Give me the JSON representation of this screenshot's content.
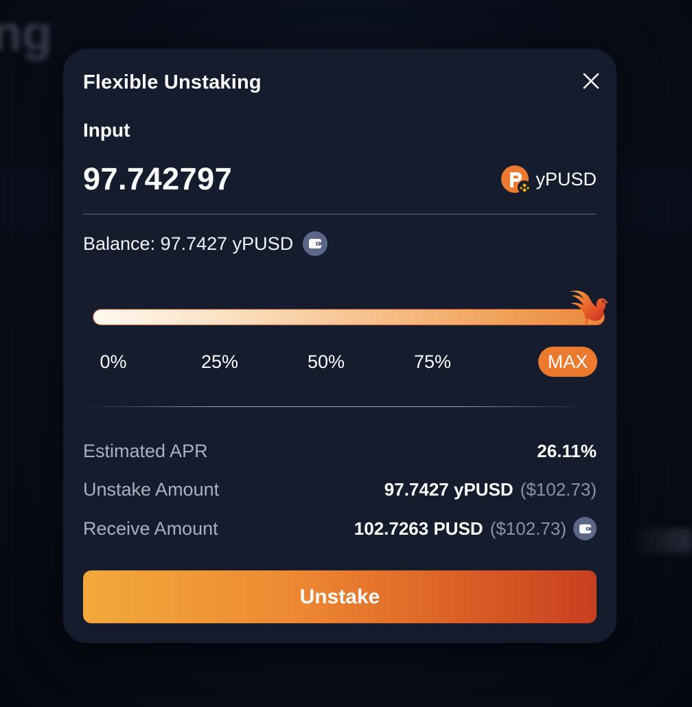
{
  "modal": {
    "title": "Flexible Unstaking",
    "input_label": "Input",
    "amount": "97.742797",
    "token": {
      "symbol": "yPUSD",
      "logo_icon": "pusd-token-logo",
      "badge_icon": "chain-badge-icon"
    },
    "balance": {
      "text": "Balance: 97.7427 yPUSD",
      "icon": "wallet-icon"
    },
    "slider": {
      "percent": 100,
      "thumb_icon": "phoenix-icon",
      "ticks": [
        "0%",
        "25%",
        "50%",
        "75%",
        "MAX"
      ],
      "active_tick": "MAX"
    },
    "info": {
      "apr": {
        "label": "Estimated APR",
        "value": "26.11%"
      },
      "unstake": {
        "label": "Unstake Amount",
        "value": "97.7427 yPUSD",
        "usd": "($102.73)"
      },
      "receive": {
        "label": "Receive Amount",
        "value": "102.7263 PUSD",
        "usd": "($102.73)",
        "icon": "wallet-icon"
      }
    },
    "button_label": "Unstake"
  },
  "colors": {
    "accent": "#ec7a2e",
    "modal_bg": "#151c2e",
    "page_bg": "#080b16"
  }
}
